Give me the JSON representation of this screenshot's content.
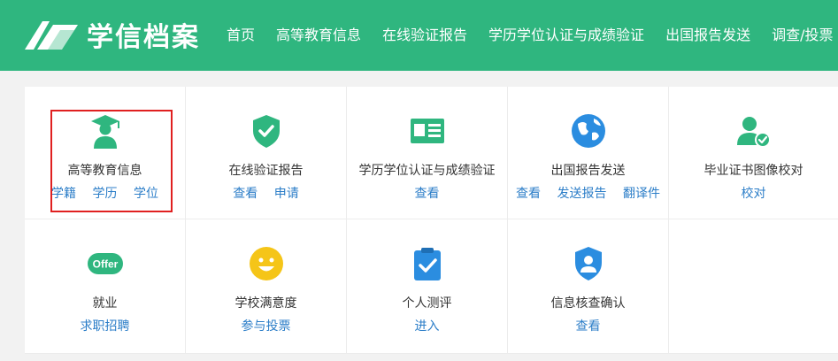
{
  "header": {
    "logo_text": "学信档案",
    "nav": [
      "首页",
      "高等教育信息",
      "在线验证报告",
      "学历学位认证与成绩验证",
      "出国报告发送",
      "调查/投票"
    ]
  },
  "grid": {
    "row1": [
      {
        "title": "高等教育信息",
        "icon": "graduate-icon",
        "links": [
          "学籍",
          "学历",
          "学位"
        ]
      },
      {
        "title": "在线验证报告",
        "icon": "shield-check-icon",
        "links": [
          "查看",
          "申请"
        ]
      },
      {
        "title": "学历学位认证与成绩验证",
        "icon": "id-card-icon",
        "links": [
          "查看"
        ]
      },
      {
        "title": "出国报告发送",
        "icon": "globe-icon",
        "links": [
          "查看",
          "发送报告",
          "翻译件"
        ]
      },
      {
        "title": "毕业证书图像校对",
        "icon": "user-check-icon",
        "links": [
          "校对"
        ]
      }
    ],
    "row2": [
      {
        "title": "就业",
        "icon": "offer-icon",
        "offer_text": "Offer",
        "links": [
          "求职招聘"
        ]
      },
      {
        "title": "学校满意度",
        "icon": "smiley-icon",
        "links": [
          "参与投票"
        ]
      },
      {
        "title": "个人测评",
        "icon": "clipboard-check-icon",
        "links": [
          "进入"
        ]
      },
      {
        "title": "信息核查确认",
        "icon": "user-shield-icon",
        "links": [
          "查看"
        ]
      }
    ]
  },
  "colors": {
    "brand_green": "#2fb67f",
    "link_blue": "#2c7ec8",
    "highlight_red": "#e02020"
  }
}
